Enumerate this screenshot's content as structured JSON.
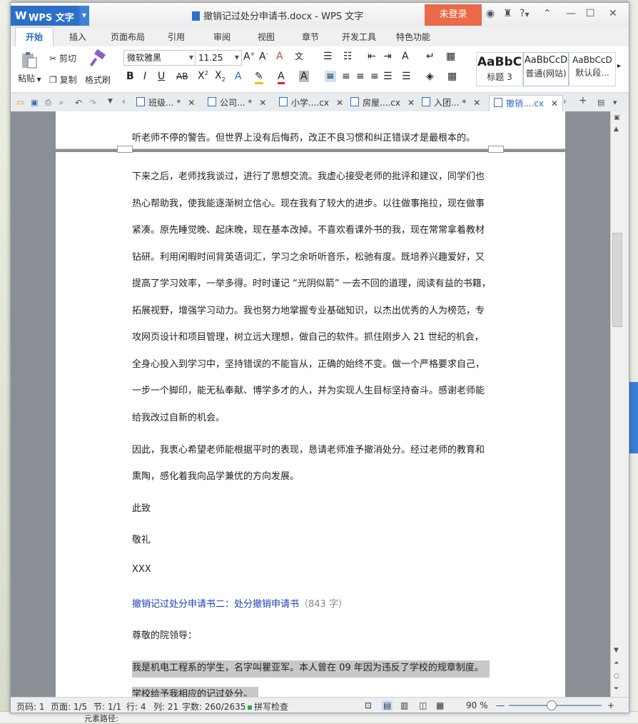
{
  "app": {
    "name": "WPS 文字",
    "document_title": "撤销记过处分申请书.docx - WPS 文字",
    "login_label": "未登录",
    "help_label": "?"
  },
  "ribbon_tabs": [
    "开始",
    "插入",
    "页面布局",
    "引用",
    "审阅",
    "视图",
    "章节",
    "开发工具",
    "特色功能"
  ],
  "ribbon": {
    "paste_label": "粘贴",
    "cut_label": "剪切",
    "copy_label": "复制",
    "format_painter_label": "格式刷",
    "font_name": "微软雅黑",
    "font_size": "11.25",
    "styles": [
      {
        "sample": "AaBbC",
        "name": "标题 3"
      },
      {
        "sample": "AaBbCcD",
        "name": "普通(网站)"
      },
      {
        "sample": "AaBbCcD",
        "name": "默认段..."
      }
    ]
  },
  "doc_tabs": [
    {
      "label": "班级... *"
    },
    {
      "label": "公司... *"
    },
    {
      "label": "小学....cx"
    },
    {
      "label": "房屋....cx"
    },
    {
      "label": "入团... *"
    },
    {
      "label": "撤销....cx"
    }
  ],
  "document": {
    "lines": [
      "听老师不停的警告。但世界上没有后悔药，改正不良习惯和纠正错误才是最根本的。",
      "下来之后，老师找我谈过，进行了思想交流。我虚心接受老师的批评和建议，同学们也",
      "热心帮助我，使我能逐渐树立信心。现在我有了较大的进步。以往做事拖拉，现在做事",
      "紧凑。原先睡觉晚、起床晚，现在基本改掉。不喜欢看课外书的我，现在常常拿着教材",
      "钻研。利用闲暇时间背英语词汇，学习之余听听音乐，松驰有度。既培养兴趣爱好，又",
      "提高了学习效率，一举多得。时时谨记 “光阴似箭” 一去不回的道理，阅读有益的书籍，",
      "拓展视野，增强学习动力。我也努力地掌握专业基础知识，以杰出优秀的人为榜范，专",
      "攻网页设计和项目管理，树立远大理想，做自己的软件。抓住刚步入 21 世纪的机会，",
      "全身心投入到学习中，坚持错误的不能盲从，正确的始终不变。做一个严格要求自己，",
      "一步一个脚印，能无私奉献、博学多才的人，并为实现人生目标坚持奋斗。感谢老师能",
      "给我改过自新的机会。",
      "因此，我衷心希望老师能根据平时的表现，恳请老师准予撤消处分。经过老师的教育和",
      "熏陶，感化着我向品学兼优的方向发展。",
      "此致",
      "敬礼",
      "XXX"
    ],
    "link_title": "撤销记过处分申请书二：处分撤销申请书",
    "link_count": "（843 字）",
    "greeting": "尊敬的院领导：",
    "selected_lines": [
      "我是机电工程系的学生，名字叫瞿亚军。本人曾在 09 年因为违反了学校的规章制度。",
      "学校给予我相应的记过处分。"
    ]
  },
  "status": {
    "page_num": "页码: 1",
    "pages": "页面: 1/5",
    "section": "节: 1/1",
    "row": "行: 4",
    "col": "列: 21",
    "word_count": "字数: 260/2635",
    "spell_check": "拼写检查",
    "zoom": "90 %",
    "zoom_level": 0.45
  },
  "background": {
    "element_path_label": "元素路径:"
  },
  "colors": {
    "accent_blue": "#2c6fc7",
    "login_orange": "#ea6a4a",
    "link_blue": "#1a3fb8",
    "selection_gray": "#c8c8c8"
  }
}
